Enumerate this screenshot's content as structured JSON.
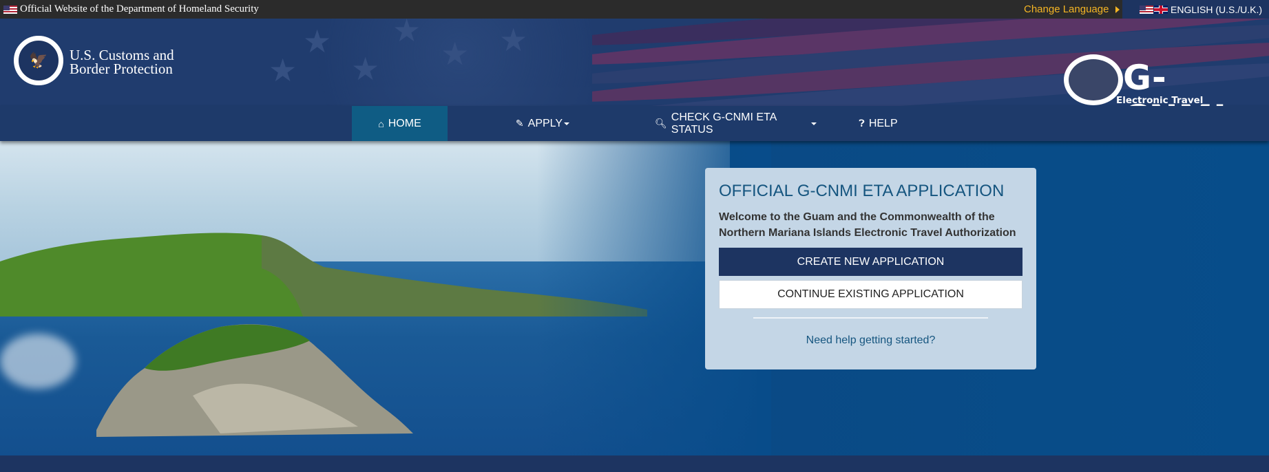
{
  "topbar": {
    "official_text": "Official Website of the Department of Homeland Security",
    "change_language": "Change Language",
    "language": "ENGLISH (U.S./U.K.)"
  },
  "header": {
    "agency_line1": "U.S. Customs and",
    "agency_line2": "Border Protection",
    "logo_title": "G-CNMI",
    "logo_subtitle": "Electronic Travel Authorization"
  },
  "nav": {
    "items": [
      {
        "label": "HOME",
        "icon": "home-icon",
        "active": true
      },
      {
        "label": "APPLY",
        "icon": "pencil-icon",
        "dropdown": true
      },
      {
        "label": "CHECK G-CNMI ETA STATUS",
        "icon": "search-icon",
        "dropdown": true
      },
      {
        "label": "HELP",
        "icon": "question-circle-icon"
      }
    ]
  },
  "card": {
    "title": "OFFICIAL G-CNMI ETA APPLICATION",
    "welcome": "Welcome to the Guam and the Commonwealth of the Northern Mariana Islands Electronic Travel Authorization",
    "create_button": "CREATE NEW APPLICATION",
    "continue_button": "CONTINUE EXISTING APPLICATION",
    "help_link": "Need help getting started?"
  },
  "colors": {
    "navy": "#1d3461",
    "active_tab": "#0f5c84",
    "card_bg": "#c4d6e6",
    "link_blue": "#15557f",
    "language_gold": "#f5b524"
  }
}
